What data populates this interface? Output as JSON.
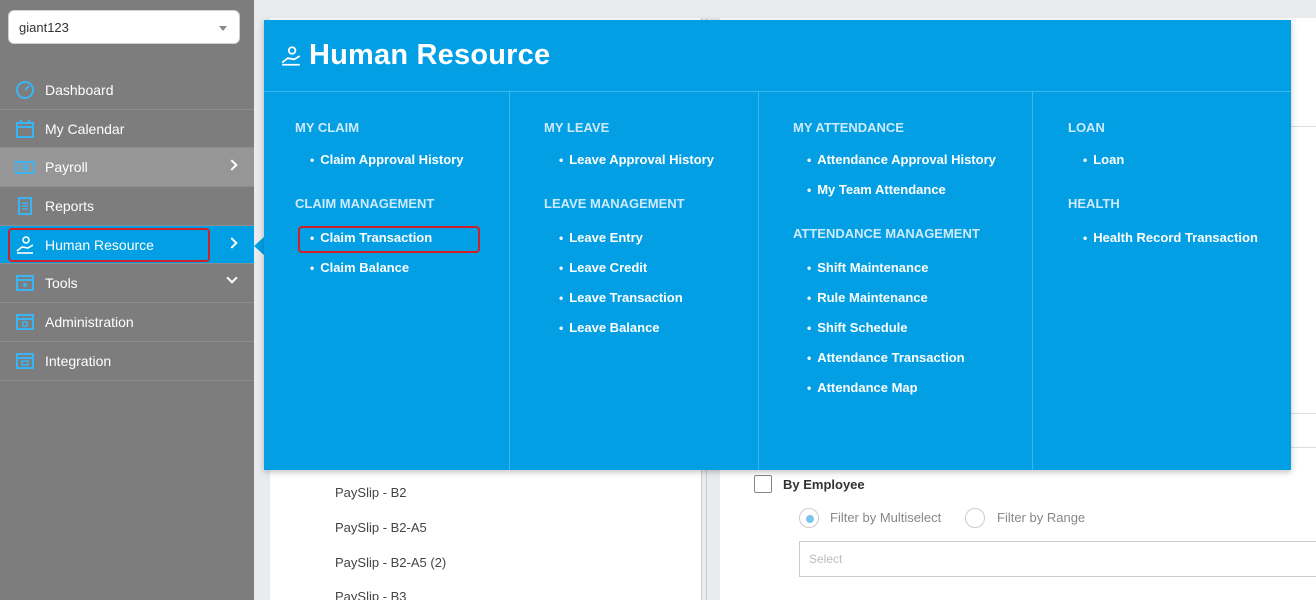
{
  "company_select": {
    "value": "giant123"
  },
  "sidebar": {
    "items": [
      {
        "label": "Dashboard",
        "icon": "gauge-icon"
      },
      {
        "label": "My Calendar",
        "icon": "calendar-icon"
      },
      {
        "label": "Payroll",
        "icon": "money-icon"
      },
      {
        "label": "Reports",
        "icon": "report-icon"
      },
      {
        "label": "Human Resource",
        "icon": "hr-icon"
      },
      {
        "label": "Tools",
        "icon": "tools-icon"
      },
      {
        "label": "Administration",
        "icon": "admin-icon"
      },
      {
        "label": "Integration",
        "icon": "integration-icon"
      }
    ]
  },
  "mega_menu": {
    "title": "Human Resource",
    "columns": [
      {
        "sections": [
          {
            "title": "MY CLAIM",
            "items": [
              "Claim Approval History"
            ]
          },
          {
            "title": "CLAIM MANAGEMENT",
            "items": [
              "Claim Transaction",
              "Claim Balance"
            ]
          }
        ]
      },
      {
        "sections": [
          {
            "title": "MY LEAVE",
            "items": [
              "Leave Approval History"
            ]
          },
          {
            "title": "LEAVE MANAGEMENT",
            "items": [
              "Leave Entry",
              "Leave Credit",
              "Leave Transaction",
              "Leave Balance"
            ]
          }
        ]
      },
      {
        "sections": [
          {
            "title": "MY ATTENDANCE",
            "items": [
              "Attendance Approval History",
              "My Team Attendance"
            ]
          },
          {
            "title": "ATTENDANCE MANAGEMENT",
            "items": [
              "Shift Maintenance",
              "Rule Maintenance",
              "Shift Schedule",
              "Attendance Transaction",
              "Attendance Map"
            ]
          }
        ]
      },
      {
        "sections": [
          {
            "title": "LOAN",
            "items": [
              "Loan"
            ]
          },
          {
            "title": "HEALTH",
            "items": [
              "Health Record Transaction"
            ]
          }
        ]
      }
    ]
  },
  "background": {
    "payslips": [
      "PaySlip - B2",
      "PaySlip - B2-A5",
      "PaySlip - B2-A5 (2)",
      "PaySlip - B3"
    ],
    "by_employee_label": "By Employee",
    "filter_multiselect": "Filter by Multiselect",
    "filter_range": "Filter by Range",
    "select_placeholder": "Select"
  },
  "colors": {
    "accent": "#029fe4",
    "sidebar": "#7d7d7d",
    "highlight": "#d0202a"
  }
}
